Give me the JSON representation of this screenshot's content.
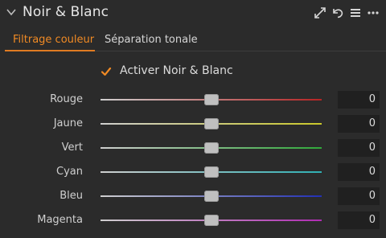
{
  "panel": {
    "title": "Noir & Blanc",
    "toolbar_icons": [
      "expand-icon",
      "reset-icon",
      "menu-icon",
      "more-icon"
    ]
  },
  "tabs": [
    {
      "label": "Filtrage couleur",
      "active": true
    },
    {
      "label": "Séparation tonale",
      "active": false
    }
  ],
  "activate": {
    "label": "Activer Noir & Blanc",
    "checked": true
  },
  "sliders": [
    {
      "label": "Rouge",
      "value": "0",
      "position": 0.5,
      "track_color": "#b52424"
    },
    {
      "label": "Jaune",
      "value": "0",
      "position": 0.5,
      "track_color": "#c9c72a"
    },
    {
      "label": "Vert",
      "value": "0",
      "position": 0.5,
      "track_color": "#30a83a"
    },
    {
      "label": "Cyan",
      "value": "0",
      "position": 0.5,
      "track_color": "#2fb0b4"
    },
    {
      "label": "Bleu",
      "value": "0",
      "position": 0.5,
      "track_color": "#2230b5"
    },
    {
      "label": "Magenta",
      "value": "0",
      "position": 0.5,
      "track_color": "#b02cb3"
    }
  ],
  "colors": {
    "accent": "#f08a24",
    "background": "#2b2b2b",
    "value_box": "#202020"
  }
}
